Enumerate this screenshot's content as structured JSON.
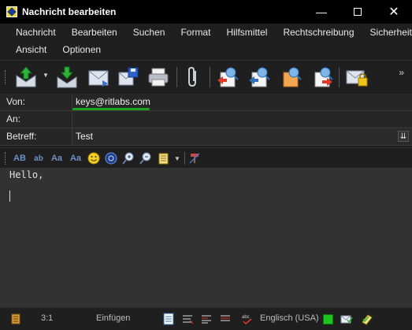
{
  "window": {
    "title": "Nachricht bearbeiten"
  },
  "menu": {
    "row1": [
      "Nachricht",
      "Bearbeiten",
      "Suchen",
      "Format",
      "Hilfsmittel",
      "Rechtschreibung",
      "Sicherheit"
    ],
    "row2": [
      "Ansicht",
      "Optionen"
    ]
  },
  "toolbar": {
    "buttons": [
      {
        "icon": "send-icon"
      },
      {
        "icon": "save-draft-icon"
      },
      {
        "icon": "queue-icon"
      },
      {
        "icon": "save-icon"
      },
      {
        "icon": "print-icon"
      },
      {
        "icon": "attach-icon"
      },
      {
        "icon": "address-to-icon"
      },
      {
        "icon": "address-cc-icon"
      },
      {
        "icon": "address-bcc-icon"
      },
      {
        "icon": "address-reply-icon"
      },
      {
        "icon": "encrypt-icon"
      }
    ]
  },
  "fields": {
    "from_label": "Von:",
    "from_value": "keys@ritlabs.com",
    "to_label": "An:",
    "to_value": "",
    "subject_label": "Betreff:",
    "subject_value": "Test"
  },
  "formatting": {
    "tools": [
      "AB",
      "ab",
      "Aa",
      "Aa"
    ]
  },
  "editor": {
    "body": "Hello,"
  },
  "status": {
    "position": "3:1",
    "mode": "Einfügen",
    "language": "Englisch (USA)"
  },
  "colors": {
    "accent_green": "#1ca51c",
    "titlebar": "#000000",
    "background": "#1f1f1f",
    "editor_bg": "#323232"
  }
}
